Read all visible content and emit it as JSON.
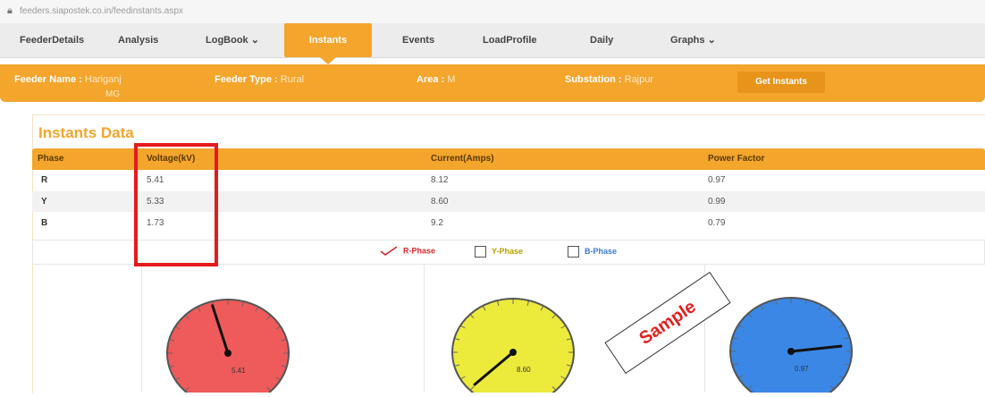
{
  "browser": {
    "url": "feeders.siapostek.co.in/feedinstants.aspx"
  },
  "nav": [
    {
      "label": "FeederDetails"
    },
    {
      "label": "Analysis"
    },
    {
      "label": "LogBook ⌄"
    },
    {
      "label": "Instants",
      "active": true
    },
    {
      "label": "Events"
    },
    {
      "label": "LoadProfile"
    },
    {
      "label": "Daily"
    },
    {
      "label": "Graphs ⌄"
    }
  ],
  "feeder": {
    "name_label": "Feeder Name :",
    "name_value": "Hariganj",
    "name_value_cont": "MG",
    "type_label": "Feeder Type :",
    "type_value": "Rural",
    "area_label": "Area :",
    "area_value": "M",
    "substation_label": "Substation :",
    "substation_value": "Rajpur",
    "button_label": "Get Instants"
  },
  "section_title": "Instants Data",
  "table": {
    "headers": [
      "Phase",
      "Voltage(kV)",
      "Current(Amps)",
      "Power Factor"
    ],
    "rows": [
      [
        "R",
        "5.41",
        "8.12",
        "0.97"
      ],
      [
        "Y",
        "5.33",
        "8.60",
        "0.99"
      ],
      [
        "B",
        "1.73",
        "9.2",
        "0.79"
      ]
    ]
  },
  "legend": [
    {
      "label": "R-Phase",
      "checked": true,
      "color": "#d62b2b"
    },
    {
      "label": "Y-Phase",
      "checked": false,
      "color": "#b8a000"
    },
    {
      "label": "B-Phase",
      "checked": false,
      "color": "#3b7bd4"
    }
  ],
  "gauges": [
    {
      "phase": "R",
      "color": "#ef5a5a",
      "value_text": "5.41",
      "needle_deg": -18
    },
    {
      "phase": "Y",
      "color": "#ecea3a",
      "value_text": "8.60",
      "needle_deg": -130
    },
    {
      "phase": "B",
      "color": "#3b87e6",
      "value_text": "0.97",
      "needle_deg": 84
    }
  ],
  "watermark": "Sample",
  "colors": {
    "accent": "#f3a52c",
    "highlight": "#e41b1b"
  }
}
